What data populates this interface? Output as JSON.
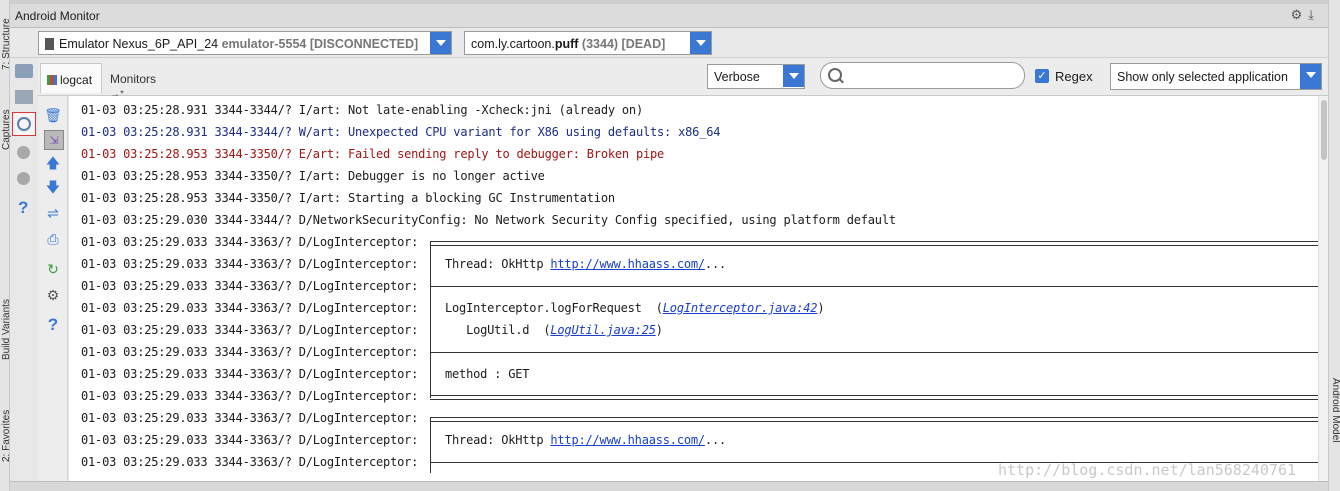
{
  "window": {
    "title": "Android Monitor"
  },
  "device_combo": {
    "name": "Emulator Nexus_6P_API_24",
    "serial": "emulator-5554 [DISCONNECTED]"
  },
  "process_combo": {
    "pkg_prefix": "com.ly.cartoon.",
    "pkg_name": "puff",
    "pid_state": "(3344) [DEAD]"
  },
  "tabs": {
    "logcat": "logcat",
    "monitors": "Monitors"
  },
  "filters": {
    "log_level": "Verbose",
    "search_value": "",
    "regex_label": "Regex",
    "regex_checked": true,
    "scope": "Show only selected application"
  },
  "side_labels": {
    "structure": "7: Structure",
    "captures": "Captures",
    "build_variants": "Build Variants",
    "favorites": "2: Favorites",
    "android_model": "Android Model"
  },
  "log_lines": [
    {
      "prefix": "01-03 03:25:28.931 3344-3344/? I/art: ",
      "msg": "Not late-enabling -Xcheck:jni (already on)",
      "level": "I"
    },
    {
      "prefix": "01-03 03:25:28.931 3344-3344/? W/art: ",
      "msg": "Unexpected CPU variant for X86 using defaults: x86_64",
      "level": "W"
    },
    {
      "prefix": "01-03 03:25:28.953 3344-3350/? E/art: ",
      "msg": "Failed sending reply to debugger: Broken pipe",
      "level": "E"
    },
    {
      "prefix": "01-03 03:25:28.953 3344-3350/? I/art: ",
      "msg": "Debugger is no longer active",
      "level": "I"
    },
    {
      "prefix": "01-03 03:25:28.953 3344-3350/? I/art: ",
      "msg": "Starting a blocking GC Instrumentation",
      "level": "I"
    },
    {
      "prefix": "01-03 03:25:29.030 3344-3344/? D/NetworkSecurityConfig: ",
      "msg": "No Network Security Config specified, using platform default",
      "level": "D"
    },
    {
      "prefix": "01-03 03:25:29.033 3344-3363/? D/LogInterceptor: ",
      "msg": "",
      "level": "D",
      "box": "top"
    },
    {
      "prefix": "01-03 03:25:29.033 3344-3363/? D/LogInterceptor: ",
      "msg": "Thread: OkHttp ",
      "url": "http://www.hhaass.com/",
      "tail": "...",
      "level": "D",
      "box": "text"
    },
    {
      "prefix": "01-03 03:25:29.033 3344-3363/? D/LogInterceptor: ",
      "msg": "",
      "level": "D",
      "box": "sep"
    },
    {
      "prefix": "01-03 03:25:29.033 3344-3363/? D/LogInterceptor: ",
      "msg": "LogInterceptor.logForRequest  (",
      "link": "LogInterceptor.java:42",
      "tail": ")",
      "level": "D",
      "box": "text"
    },
    {
      "prefix": "01-03 03:25:29.033 3344-3363/? D/LogInterceptor: ",
      "msg": "   LogUtil.d  (",
      "link": "LogUtil.java:25",
      "tail": ")",
      "level": "D",
      "box": "text"
    },
    {
      "prefix": "01-03 03:25:29.033 3344-3363/? D/LogInterceptor: ",
      "msg": "",
      "level": "D",
      "box": "sep"
    },
    {
      "prefix": "01-03 03:25:29.033 3344-3363/? D/LogInterceptor: ",
      "msg": "method : GET",
      "level": "D",
      "box": "text"
    },
    {
      "prefix": "01-03 03:25:29.033 3344-3363/? D/LogInterceptor: ",
      "msg": "",
      "level": "D",
      "box": "bottom"
    },
    {
      "prefix": "01-03 03:25:29.033 3344-3363/? D/LogInterceptor: ",
      "msg": "",
      "level": "D",
      "box": "top"
    },
    {
      "prefix": "01-03 03:25:29.033 3344-3363/? D/LogInterceptor: ",
      "msg": "Thread: OkHttp ",
      "url": "http://www.hhaass.com/",
      "tail": "...",
      "level": "D",
      "box": "text"
    },
    {
      "prefix": "01-03 03:25:29.033 3344-3363/? D/LogInterceptor: ",
      "msg": "",
      "level": "D",
      "box": "sep"
    }
  ],
  "watermark": "http://blog.csdn.net/lan568240761",
  "colors": {
    "accent": "#3a78d4",
    "warn": "#1b2c86",
    "error": "#a11515",
    "link": "#1a3fc8"
  }
}
